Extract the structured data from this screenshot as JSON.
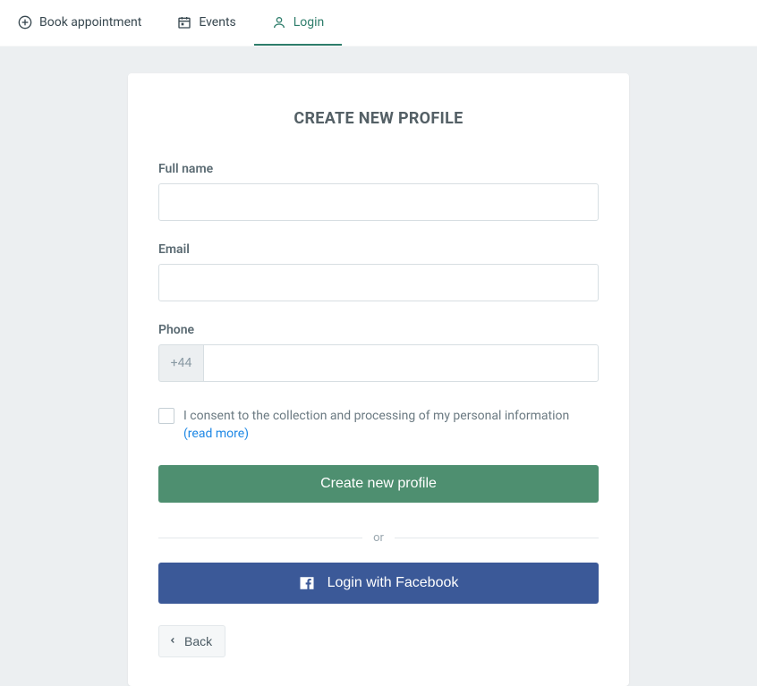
{
  "tabs": {
    "book": "Book appointment",
    "events": "Events",
    "login": "Login"
  },
  "card": {
    "title": "CREATE NEW PROFILE"
  },
  "form": {
    "fullname_label": "Full name",
    "fullname_value": "",
    "email_label": "Email",
    "email_value": "",
    "phone_label": "Phone",
    "phone_prefix": "+44",
    "phone_value": "",
    "consent_text": "I consent to the collection and processing of my personal information",
    "consent_readmore": "(read more)"
  },
  "buttons": {
    "create": "Create new profile",
    "facebook": "Login with Facebook",
    "back": "Back"
  },
  "divider": {
    "text": "or"
  }
}
